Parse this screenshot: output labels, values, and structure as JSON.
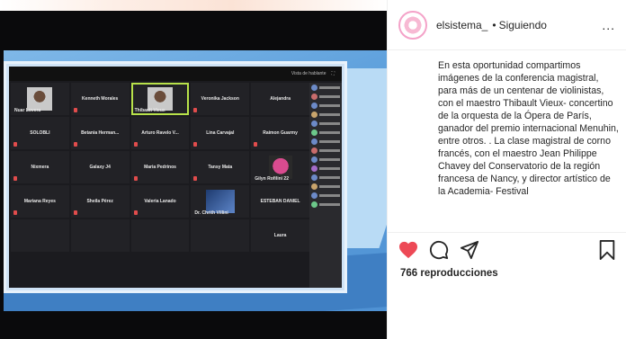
{
  "instagram": {
    "username": "elsistema_",
    "separator": "•",
    "follow_status": "Siguiendo",
    "more_label": "...",
    "caption": "En esta oportunidad compartimos imágenes de la conferencia magistral, para más de un centenar de violinistas, con el maestro Thibault Vieux- concertino de la orquesta de la Ópera de París, ganador del premio internacional Menuhin, entre otros. . La clase magistral de corno francés, con el maestro Jean Philippe Chavey del Conservatorio de la región francesa de Nancy, y director artístico de la Academia- Festival",
    "views_label": "766 reproducciones",
    "liked": true,
    "colors": {
      "like": "#ed4956",
      "text": "#262626"
    }
  },
  "video": {
    "toolbar": [
      "Vista de hablante",
      "⛶"
    ],
    "tiles": [
      "Nuar Lovera",
      "Kenneth Morales",
      "Thibault Vieux",
      "Veronika Jackson",
      "Alejandra",
      "SOLOBLI",
      "Betania Herman...",
      "Arturo Ravelo V...",
      "Lina Carvajal",
      "Raimon Guarmy",
      "Nixmera",
      "Galaxy J4",
      "Maria Pedrinos",
      "Tansy Mata",
      "Gilyn Rofilini 22",
      "Mariana Reyes",
      "Sheila Pérez",
      "Valeria Lanado",
      "Dr. Chrith Villini",
      "ESTEBAN DANIEL",
      "",
      "",
      "",
      "",
      "Laura"
    ]
  }
}
